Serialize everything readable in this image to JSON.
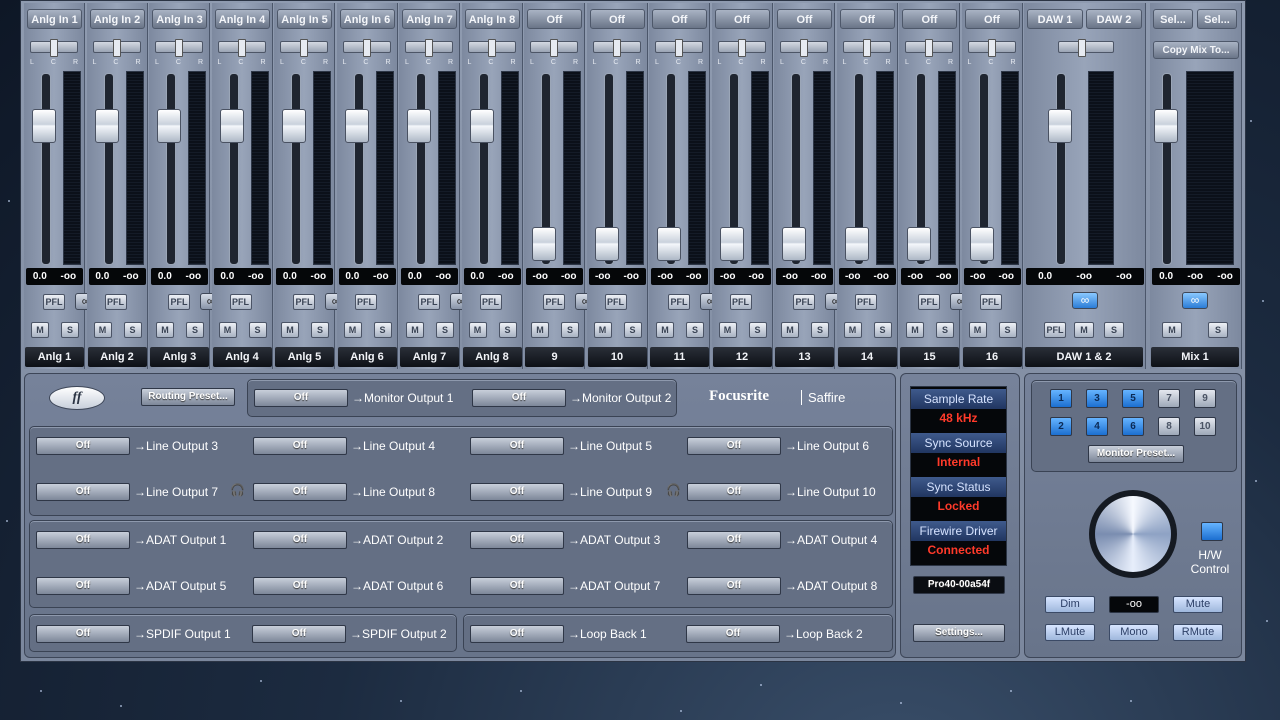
{
  "channels": [
    {
      "name": "Anlg In 1",
      "label": "Anlg 1",
      "gain": "0.0",
      "peak": "-oo",
      "fader_pos": 0.72,
      "link_on": false
    },
    {
      "name": "Anlg In 2",
      "label": "Anlg 2",
      "gain": "0.0",
      "peak": "-oo",
      "fader_pos": 0.72,
      "link_on": false
    },
    {
      "name": "Anlg In 3",
      "label": "Anlg 3",
      "gain": "0.0",
      "peak": "-oo",
      "fader_pos": 0.72,
      "link_on": false
    },
    {
      "name": "Anlg In 4",
      "label": "Anlg 4",
      "gain": "0.0",
      "peak": "-oo",
      "fader_pos": 0.72,
      "link_on": false
    },
    {
      "name": "Anlg In 5",
      "label": "Anlg 5",
      "gain": "0.0",
      "peak": "-oo",
      "fader_pos": 0.72,
      "link_on": false
    },
    {
      "name": "Anlg In 6",
      "label": "Anlg 6",
      "gain": "0.0",
      "peak": "-oo",
      "fader_pos": 0.72,
      "link_on": false
    },
    {
      "name": "Anlg In 7",
      "label": "Anlg 7",
      "gain": "0.0",
      "peak": "-oo",
      "fader_pos": 0.72,
      "link_on": false
    },
    {
      "name": "Anlg In 8",
      "label": "Anlg 8",
      "gain": "0.0",
      "peak": "-oo",
      "fader_pos": 0.72,
      "link_on": false
    },
    {
      "name": "Off",
      "label": "9",
      "gain": "-oo",
      "peak": "-oo",
      "fader_pos": 0.1,
      "link_on": false
    },
    {
      "name": "Off",
      "label": "10",
      "gain": "-oo",
      "peak": "-oo",
      "fader_pos": 0.1,
      "link_on": false
    },
    {
      "name": "Off",
      "label": "11",
      "gain": "-oo",
      "peak": "-oo",
      "fader_pos": 0.1,
      "link_on": false
    },
    {
      "name": "Off",
      "label": "12",
      "gain": "-oo",
      "peak": "-oo",
      "fader_pos": 0.1,
      "link_on": false
    },
    {
      "name": "Off",
      "label": "13",
      "gain": "-oo",
      "peak": "-oo",
      "fader_pos": 0.1,
      "link_on": false
    },
    {
      "name": "Off",
      "label": "14",
      "gain": "-oo",
      "peak": "-oo",
      "fader_pos": 0.1,
      "link_on": false
    },
    {
      "name": "Off",
      "label": "15",
      "gain": "-oo",
      "peak": "-oo",
      "fader_pos": 0.1,
      "link_on": false
    },
    {
      "name": "Off",
      "label": "16",
      "gain": "-oo",
      "peak": "-oo",
      "fader_pos": 0.1,
      "link_on": false
    }
  ],
  "strip_buttons": {
    "pfl": "PFL",
    "mute": "M",
    "solo": "S",
    "link": "∞"
  },
  "daw": {
    "sel1": "DAW 1",
    "sel2": "DAW 2",
    "gain": "0.0",
    "peak1": "-oo",
    "peak2": "-oo",
    "label": "DAW 1 & 2",
    "fader_pos": 0.72
  },
  "mix": {
    "sel1": "Sel...",
    "sel2": "Sel...",
    "copy": "Copy Mix To...",
    "gain": "0.0",
    "peak1": "-oo",
    "peak2": "-oo",
    "label": "Mix 1",
    "fader_pos": 0.72
  },
  "routing_preset": "Routing Preset...",
  "brand": {
    "name": "Focusrite",
    "product": "Saffire"
  },
  "off": "Off",
  "monitor_outputs": [
    "→Monitor Output 1",
    "→Monitor Output 2"
  ],
  "line_outputs": [
    "→Line Output 3",
    "→Line Output 4",
    "→Line Output 5",
    "→Line Output 6",
    "→Line Output 7",
    "→Line Output 8",
    "→Line Output 9",
    "→Line Output 10"
  ],
  "adat_outputs": [
    "→ADAT Output 1",
    "→ADAT Output 2",
    "→ADAT Output 3",
    "→ADAT Output 4",
    "→ADAT Output 5",
    "→ADAT Output 6",
    "→ADAT Output 7",
    "→ADAT Output 8"
  ],
  "spdif_outputs": [
    "→SPDIF Output 1",
    "→SPDIF Output 2"
  ],
  "loopback": [
    "→Loop Back 1",
    "→Loop Back 2"
  ],
  "status": {
    "sample_rate_label": "Sample Rate",
    "sample_rate": "48 kHz",
    "sync_source_label": "Sync Source",
    "sync_source": "Internal",
    "sync_status_label": "Sync Status",
    "sync_status": "Locked",
    "firewire_label": "Firewire Driver",
    "firewire": "Connected",
    "device": "Pro40-00a54f",
    "settings": "Settings..."
  },
  "monitor": {
    "numbers_top": [
      "1",
      "3",
      "5",
      "7",
      "9"
    ],
    "numbers_bottom": [
      "2",
      "4",
      "6",
      "8",
      "10"
    ],
    "preset": "Monitor Preset...",
    "hw_label": "H/W",
    "hw_label2": "Control",
    "level": "-oo",
    "dim": "Dim",
    "mute": "Mute",
    "lmute": "LMute",
    "mono": "Mono",
    "rmute": "RMute"
  },
  "colors": {
    "accent_blue": "#2b7cd6",
    "status_red": "#ff3a2a"
  }
}
